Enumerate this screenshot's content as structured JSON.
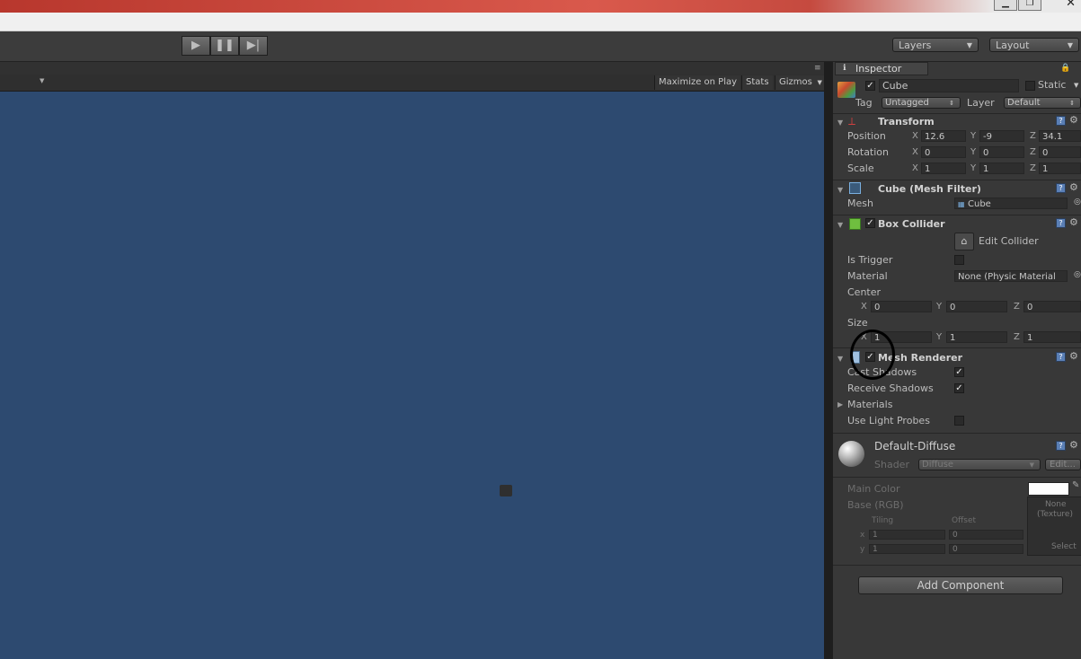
{
  "toolbar": {
    "play_icon": "play-icon",
    "pause_icon": "pause-icon",
    "step_icon": "step-icon",
    "layers": "Layers",
    "layout": "Layout"
  },
  "game_toolbar": {
    "maximize": "Maximize on Play",
    "stats": "Stats",
    "gizmos": "Gizmos"
  },
  "inspector": {
    "tab": "Inspector",
    "object_name": "Cube",
    "static_label": "Static",
    "tag_label": "Tag",
    "tag_value": "Untagged",
    "layer_label": "Layer",
    "layer_value": "Default",
    "transform": {
      "title": "Transform",
      "position_label": "Position",
      "rotation_label": "Rotation",
      "scale_label": "Scale",
      "position": {
        "x": "12.6",
        "y": "-9",
        "z": "34.1"
      },
      "rotation": {
        "x": "0",
        "y": "0",
        "z": "0"
      },
      "scale": {
        "x": "1",
        "y": "1",
        "z": "1"
      }
    },
    "mesh_filter": {
      "title": "Cube (Mesh Filter)",
      "mesh_label": "Mesh",
      "mesh_value": "Cube"
    },
    "box_collider": {
      "title": "Box Collider",
      "edit_collider": "Edit Collider",
      "is_trigger": "Is Trigger",
      "material_label": "Material",
      "material_value": "None (Physic Material",
      "center_label": "Center",
      "center": {
        "x": "0",
        "y": "0",
        "z": "0"
      },
      "size_label": "Size",
      "size": {
        "x": "1",
        "y": "1",
        "z": "1"
      }
    },
    "mesh_renderer": {
      "title": "Mesh Renderer",
      "cast_shadows": "Cast Shadows",
      "receive_shadows": "Receive Shadows",
      "materials": "Materials",
      "use_light_probes": "Use Light Probes"
    },
    "material": {
      "name": "Default-Diffuse",
      "shader_label": "Shader",
      "shader_value": "Diffuse",
      "edit": "Edit...",
      "main_color": "Main Color",
      "base_rgb": "Base (RGB)",
      "tiling": "Tiling",
      "offset": "Offset",
      "texture_none": "None",
      "texture_type": "(Texture)",
      "select": "Select",
      "tiling_x": "1",
      "tiling_y": "1",
      "offset_x": "0",
      "offset_y": "0"
    },
    "add_component": "Add Component",
    "axes": {
      "x": "X",
      "y": "Y",
      "z": "Z",
      "x_small": "x",
      "y_small": "y"
    }
  },
  "colors": {
    "game_view_bg": "#2d4a70",
    "inspector_bg": "#383838",
    "main_color_swatch": "#ffffff"
  }
}
